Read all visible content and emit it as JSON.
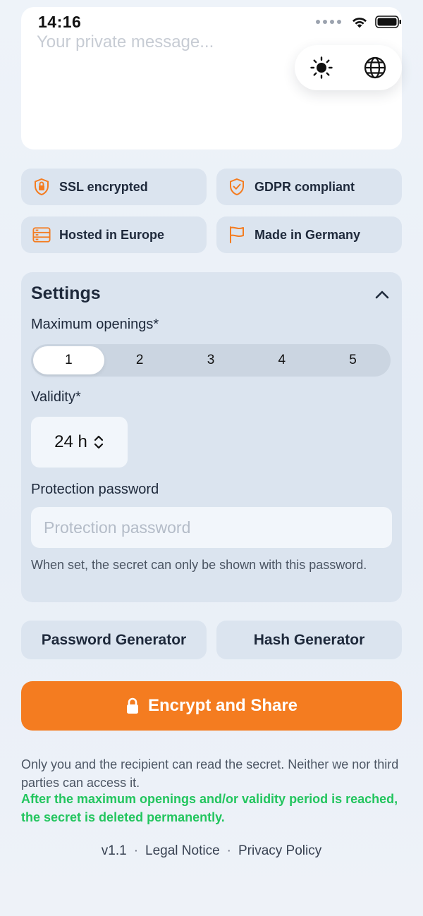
{
  "status": {
    "time": "14:16"
  },
  "message": {
    "placeholder": "Your private message..."
  },
  "badges": [
    {
      "label": "SSL encrypted",
      "icon": "shield-lock-icon"
    },
    {
      "label": "GDPR compliant",
      "icon": "shield-check-icon"
    },
    {
      "label": "Hosted in Europe",
      "icon": "server-icon"
    },
    {
      "label": "Made in Germany",
      "icon": "flag-icon"
    }
  ],
  "settings": {
    "title": "Settings",
    "max_openings_label": "Maximum openings*",
    "openings": [
      "1",
      "2",
      "3",
      "4",
      "5"
    ],
    "openings_selected": "1",
    "validity_label": "Validity*",
    "validity_value": "24 h",
    "password_label": "Protection password",
    "password_placeholder": "Protection password",
    "password_hint": "When set, the secret can only be shown with this password."
  },
  "tools": {
    "password_generator": "Password Generator",
    "hash_generator": "Hash Generator"
  },
  "cta": {
    "label": "Encrypt and Share"
  },
  "info": {
    "privacy": "Only you and the recipient can read the secret. Neither we nor third parties can access it.",
    "deletion": "After the maximum openings and/or validity period is reached, the secret is deleted permanently."
  },
  "footer": {
    "version": "v1.1",
    "legal": "Legal Notice",
    "privacy": "Privacy Policy",
    "separator": "·"
  },
  "colors": {
    "accent": "#f47c20",
    "success": "#22c55e",
    "card": "#dbe4ef"
  }
}
